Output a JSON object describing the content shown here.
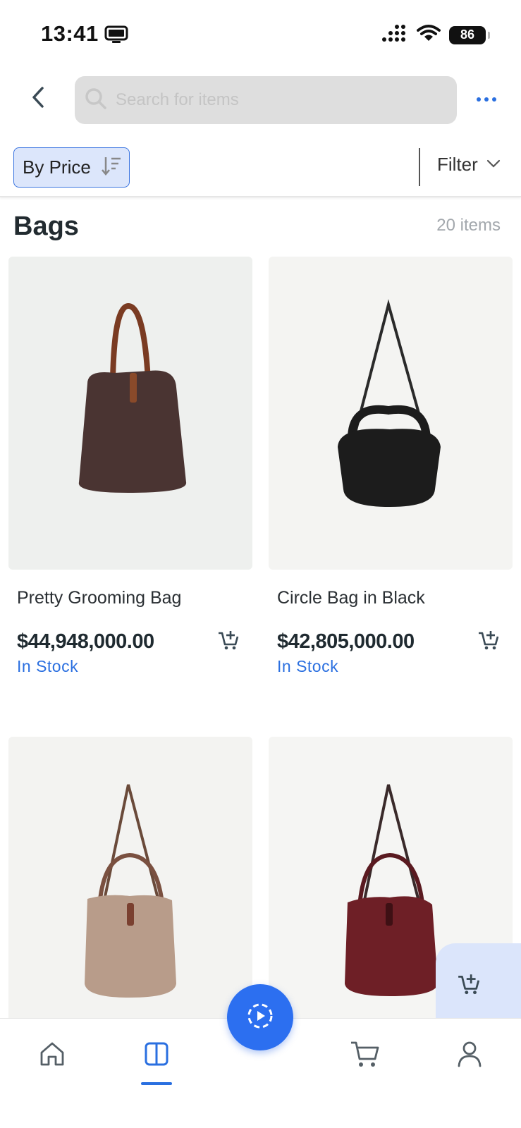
{
  "status_bar": {
    "time": "13:41",
    "battery": "86"
  },
  "header": {
    "search_placeholder": "Search for items"
  },
  "sortbar": {
    "sort_label": "By Price",
    "filter_label": "Filter"
  },
  "section": {
    "title": "Bags",
    "count": "20 items"
  },
  "products": [
    {
      "name": "Pretty Grooming Bag",
      "price": "$44,948,000.00",
      "stock": "In Stock",
      "bag_color": "#4a3432"
    },
    {
      "name": "Circle Bag in Black",
      "price": "$42,805,000.00",
      "stock": "In Stock",
      "bag_color": "#1c1c1c"
    },
    {
      "name": "",
      "price": "",
      "stock": "",
      "bag_color": "#b89c8a"
    },
    {
      "name": "",
      "price": "",
      "stock": "",
      "bag_color": "#6e1f26"
    }
  ],
  "colors": {
    "accent": "#2a6fe0",
    "chip_bg": "#dce6fb",
    "search_bg": "#dedede"
  }
}
